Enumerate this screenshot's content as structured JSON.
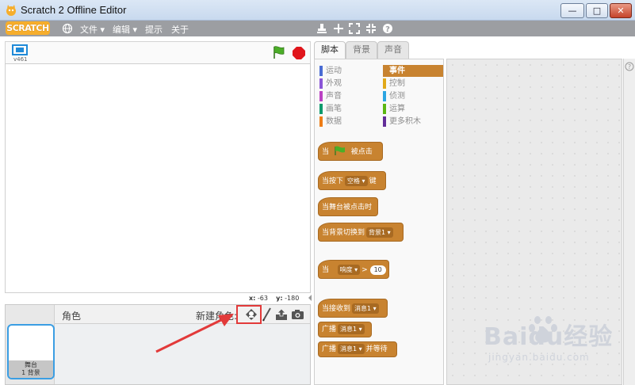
{
  "window": {
    "title": "Scratch 2 Offline Editor",
    "minimize": "—",
    "maximize": "□",
    "close": "✕"
  },
  "menubar": {
    "logo": "SCRATCH",
    "file": "文件 ▾",
    "edit": "编辑 ▾",
    "tips": "提示",
    "about": "关于",
    "icons": [
      "stamp-icon",
      "cut-icon",
      "grow-icon",
      "shrink-icon",
      "help-icon"
    ]
  },
  "stage": {
    "version": "v461",
    "coords_x_label": "x:",
    "coords_x": "-63",
    "coords_y_label": "y:",
    "coords_y": "-180"
  },
  "sprites": {
    "label": "角色",
    "new_sprite_label": "新建角色:",
    "stage_name": "舞台",
    "stage_backdrops": "1 背景"
  },
  "tabs": [
    "脚本",
    "背景",
    "声音"
  ],
  "categories": [
    {
      "label": "运动",
      "color": "#4a6cd4"
    },
    {
      "label": "事件",
      "color": "#c88330",
      "active": true
    },
    {
      "label": "外观",
      "color": "#8a55d7"
    },
    {
      "label": "控制",
      "color": "#e1a91a"
    },
    {
      "label": "声音",
      "color": "#bb42c3"
    },
    {
      "label": "侦测",
      "color": "#2ca5e2"
    },
    {
      "label": "画笔",
      "color": "#0e9a6c"
    },
    {
      "label": "运算",
      "color": "#5cb712"
    },
    {
      "label": "数据",
      "color": "#ee7d16"
    },
    {
      "label": "更多积木",
      "color": "#632d99"
    }
  ],
  "blocks": {
    "flag_clicked_pre": "当",
    "flag_clicked_post": "被点击",
    "key_pressed_pre": "当按下",
    "key_pressed_key": "空格",
    "key_pressed_post": "键",
    "stage_clicked": "当舞台被点击时",
    "backdrop_switch_pre": "当背景切换到",
    "backdrop_switch_value": "背景1",
    "loudness_pre": "当",
    "loudness_value": "响度",
    "loudness_op": ">",
    "loudness_num": "10",
    "receive_pre": "当接收到",
    "receive_value": "消息1",
    "broadcast_pre": "广播",
    "broadcast_value": "消息1",
    "broadcast_wait_pre": "广播",
    "broadcast_wait_value": "消息1",
    "broadcast_wait_post": "并等待"
  },
  "watermark": {
    "main": "Baidu经验",
    "sub": "jingyan.baidu.com"
  },
  "colors": {
    "events": "#c88330",
    "highlight": "#e23a3a",
    "menubar": "#9c9ea2",
    "selection": "#3b9ee3"
  }
}
